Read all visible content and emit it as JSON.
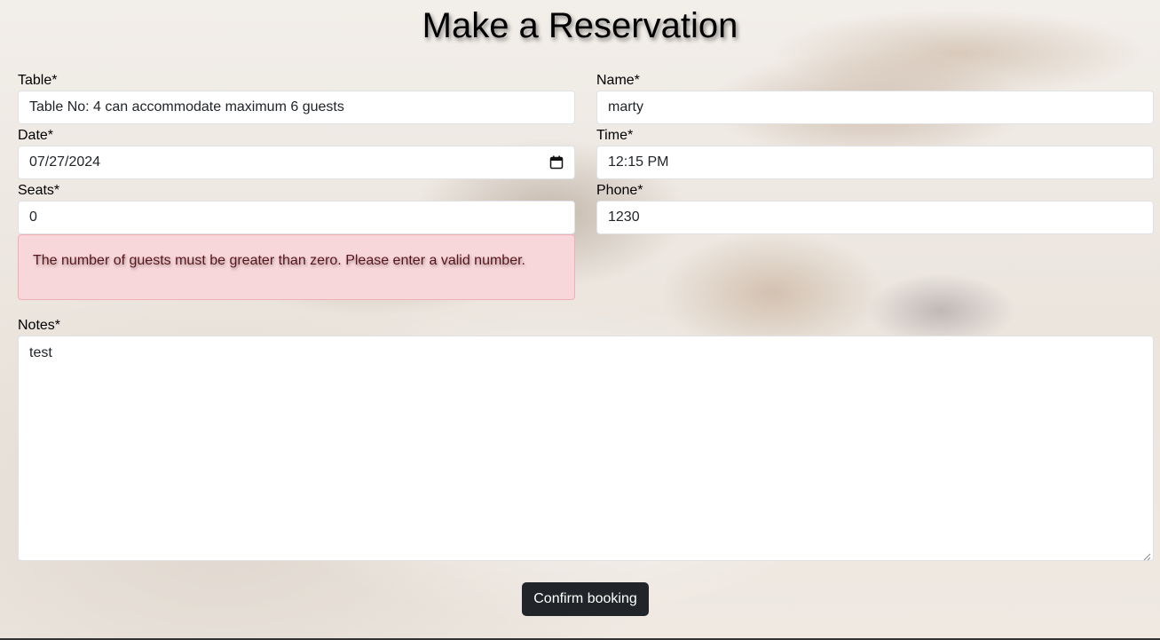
{
  "page_title": "Make a Reservation",
  "fields": {
    "table": {
      "label": "Table*",
      "value": "Table No: 4 can accommodate maximum 6 guests"
    },
    "name": {
      "label": "Name*",
      "value": "marty"
    },
    "date": {
      "label": "Date*",
      "value": "07/27/2024"
    },
    "time": {
      "label": "Time*",
      "value": "12:15 PM"
    },
    "seats": {
      "label": "Seats*",
      "value": "0"
    },
    "phone": {
      "label": "Phone*",
      "value": "1230"
    },
    "notes": {
      "label": "Notes*",
      "value": "test"
    }
  },
  "error_message": "The number of guests must be greater than zero. Please enter a valid number.",
  "submit_label": "Confirm booking",
  "icons": {
    "date": "calendar-icon"
  },
  "colors": {
    "button_bg": "#212529",
    "alert_bg": "#f8d7da",
    "alert_border": "#f1aeb5"
  }
}
